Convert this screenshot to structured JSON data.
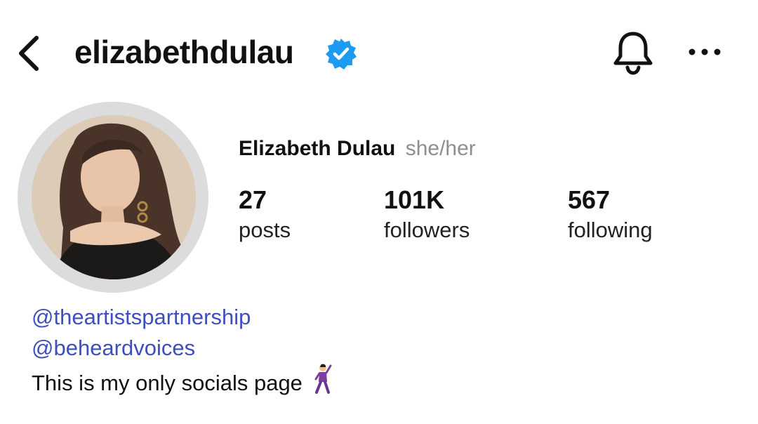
{
  "header": {
    "username": "elizabethdulau",
    "icons": {
      "back": "chevron-left-icon",
      "verified": "verified-badge-icon",
      "notifications": "bell-icon",
      "more": "ellipsis-icon"
    },
    "colors": {
      "verified": "#1d9bf0"
    }
  },
  "profile": {
    "display_name": "Elizabeth Dulau",
    "pronouns": "she/her",
    "stats": [
      {
        "value": "27",
        "label": "posts"
      },
      {
        "value": "101K",
        "label": "followers"
      },
      {
        "value": "567",
        "label": "following"
      }
    ]
  },
  "bio": {
    "links": [
      "@theartistspartnership",
      "@beheardvoices"
    ],
    "text": "This is my only socials page",
    "emoji": "man-dancing-emoji",
    "link_color": "#3d4fbf"
  }
}
